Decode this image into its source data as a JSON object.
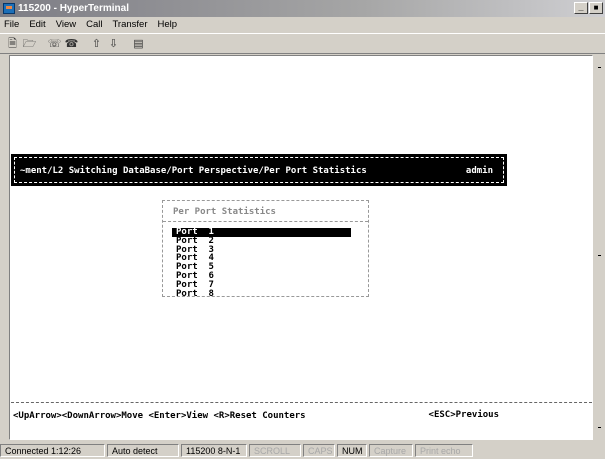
{
  "window": {
    "title": "115200 - HyperTerminal",
    "min_label": "_",
    "close_label": "×"
  },
  "menu": [
    "File",
    "Edit",
    "View",
    "Call",
    "Transfer",
    "Help"
  ],
  "toolbar": {
    "icons": [
      "new-file-icon",
      "open-folder-icon",
      "call-icon",
      "disconnect-icon",
      "send-icon",
      "receive-icon",
      "properties-icon"
    ]
  },
  "terminal": {
    "header_path": "~ment/L2 Switching DataBase/Port Perspective/Per Port Statistics",
    "header_user": "admin",
    "stats_title": "Per Port Statistics",
    "ports": [
      "Port  1",
      "Port  2",
      "Port  3",
      "Port  4",
      "Port  5",
      "Port  6",
      "Port  7",
      "Port  8"
    ],
    "selected_port_index": 0,
    "footer_nav": "<UpArrow><DownArrow>Move <Enter>View <R>Reset Counters",
    "footer_prev": "<ESC>Previous"
  },
  "status": {
    "connected": "Connected 1:12:26",
    "detect": "Auto detect",
    "settings": "115200 8-N-1",
    "scroll": "SCROLL",
    "caps": "CAPS",
    "num": "NUM",
    "capture": "Capture",
    "print_echo": "Print echo"
  }
}
